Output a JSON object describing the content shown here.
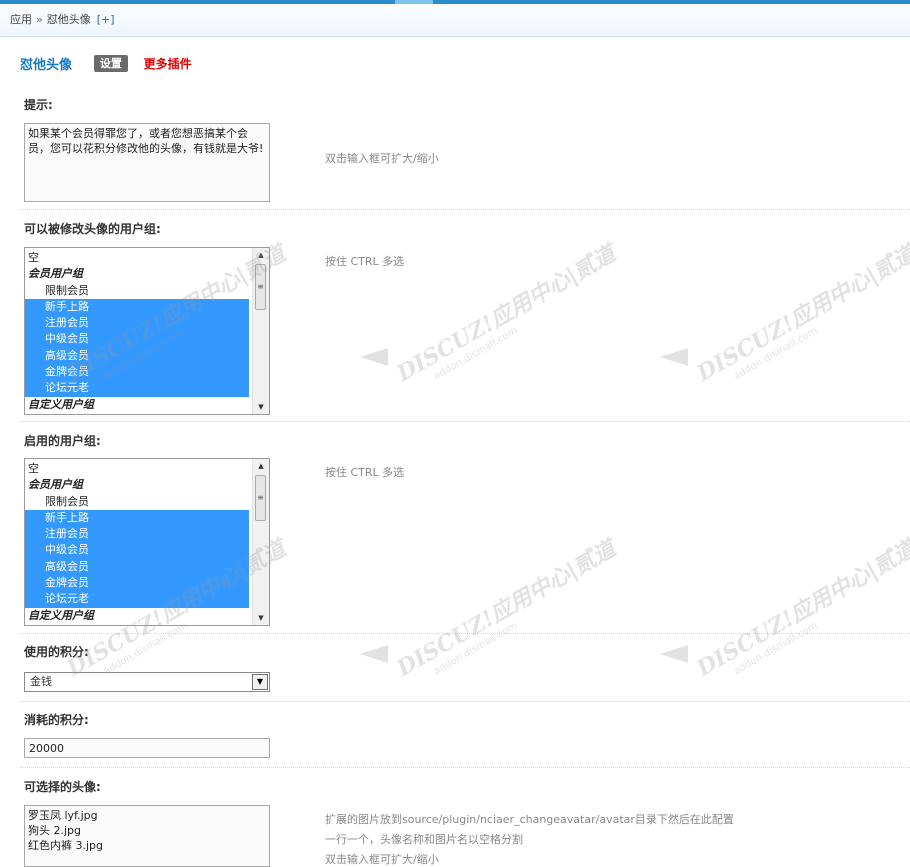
{
  "breadcrumb": {
    "items": [
      "应用",
      "怼他头像"
    ],
    "separator": "»",
    "add_label": "[+]"
  },
  "plugin": {
    "name": "怼他头像",
    "settings_label": "设置",
    "more_label": "更多插件"
  },
  "tip": {
    "label": "提示:",
    "value": "如果某个会员得罪您了，或者您想恶搞某个会员，您可以花积分修改他的头像，有钱就是大爷!",
    "hint": "双击输入框可扩大/缩小"
  },
  "modifiable_groups": {
    "label": "可以被修改头像的用户组:",
    "hint": "按住 CTRL 多选",
    "options": [
      {
        "text": "空",
        "kind": "plain",
        "selected": false
      },
      {
        "text": "会员用户组",
        "kind": "group",
        "selected": false
      },
      {
        "text": "限制会员",
        "kind": "child",
        "selected": false
      },
      {
        "text": "新手上路",
        "kind": "child",
        "selected": true
      },
      {
        "text": "注册会员",
        "kind": "child",
        "selected": true
      },
      {
        "text": "中级会员",
        "kind": "child",
        "selected": true
      },
      {
        "text": "高级会员",
        "kind": "child",
        "selected": true
      },
      {
        "text": "金牌会员",
        "kind": "child",
        "selected": true
      },
      {
        "text": "论坛元老",
        "kind": "child",
        "selected": true
      },
      {
        "text": "自定义用户组",
        "kind": "group",
        "selected": false
      }
    ]
  },
  "enabled_groups": {
    "label": "启用的用户组:",
    "hint": "按住 CTRL 多选",
    "options": [
      {
        "text": "空",
        "kind": "plain",
        "selected": false
      },
      {
        "text": "会员用户组",
        "kind": "group",
        "selected": false
      },
      {
        "text": "限制会员",
        "kind": "child",
        "selected": false
      },
      {
        "text": "新手上路",
        "kind": "child",
        "selected": true
      },
      {
        "text": "注册会员",
        "kind": "child",
        "selected": true
      },
      {
        "text": "中级会员",
        "kind": "child",
        "selected": true
      },
      {
        "text": "高级会员",
        "kind": "child",
        "selected": true
      },
      {
        "text": "金牌会员",
        "kind": "child",
        "selected": true
      },
      {
        "text": "论坛元老",
        "kind": "child",
        "selected": true
      },
      {
        "text": "自定义用户组",
        "kind": "group",
        "selected": false
      }
    ]
  },
  "credit_type": {
    "label": "使用的积分:",
    "selected": "金钱"
  },
  "credit_cost": {
    "label": "消耗的积分:",
    "value": "20000"
  },
  "avatars": {
    "label": "可选择的头像:",
    "value": "罗玉凤 lyf.jpg\n狗头 2.jpg\n红色内裤 3.jpg",
    "hints": [
      "扩展的图片放到source/plugin/nciaer_changeavatar/avatar目录下然后在此配置",
      "一行一个，头像名称和图片名以空格分割",
      "双击输入框可扩大/缩小"
    ]
  },
  "watermark": {
    "text": "DISCUZ!应用中心|贰道",
    "sub": "addon.dismall.com"
  },
  "colors": {
    "accent": "#1479c4",
    "selection": "#3399ff",
    "more_link": "#e60000",
    "top_bar": "#2a8cc8"
  }
}
